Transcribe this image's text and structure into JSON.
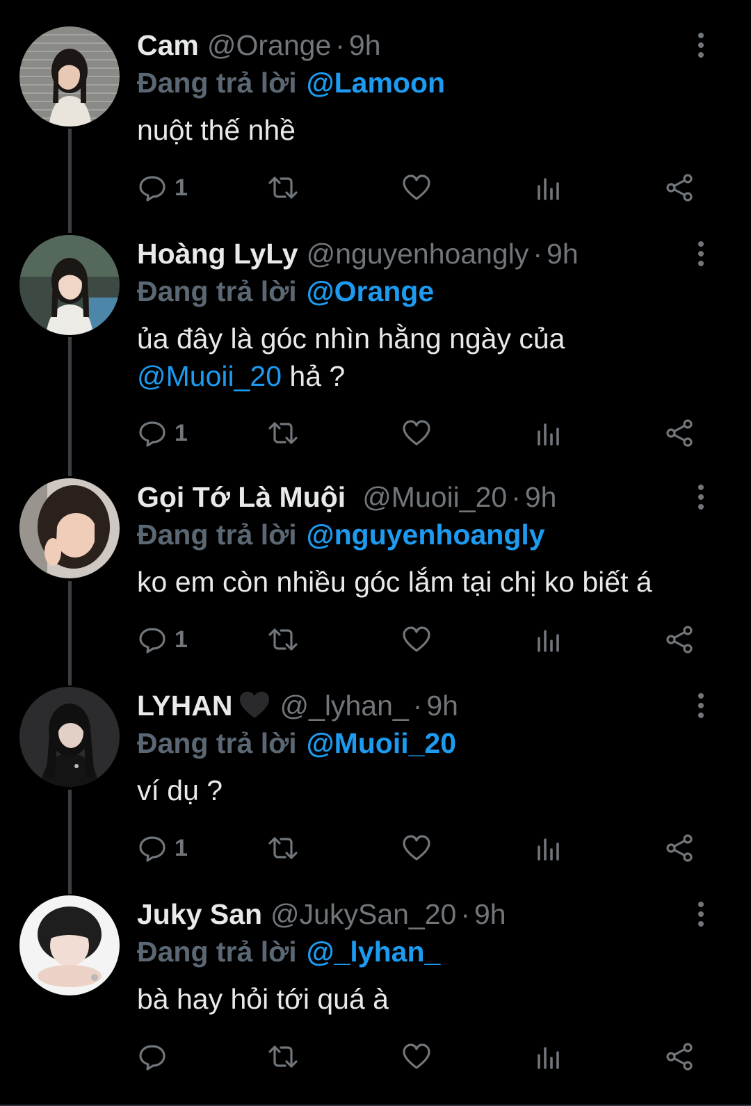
{
  "colors": {
    "background": "#000000",
    "text": "#e7e9ea",
    "muted": "#71767b",
    "accent": "#1d9bf0",
    "thread_line": "#3b3f44"
  },
  "icons": {
    "reply": "speech-bubble-icon",
    "retweet": "retweet-icon",
    "like": "heart-icon",
    "views": "bar-chart-icon",
    "share": "share-icon",
    "more": "vertical-ellipsis-icon"
  },
  "tweets": [
    {
      "display_name": "Cam",
      "handle": "@Orange",
      "dot": "·",
      "time": "9h",
      "reply_prefix": "Đang trả lời",
      "reply_to": "@Lamoon",
      "text_before": "nuột thế nhề",
      "text_mention": "",
      "text_after": "",
      "reply_count": "1"
    },
    {
      "display_name": "Hoàng LyLy",
      "handle": "@nguyenhoangly",
      "dot": "·",
      "time": "9h",
      "reply_prefix": "Đang trả lời",
      "reply_to": "@Orange",
      "text_before": "ủa đây là góc nhìn hằng ngày của ",
      "text_mention": "@Muoii_20",
      "text_after": " hả ?",
      "reply_count": "1"
    },
    {
      "display_name": "Gọi Tớ Là Muội",
      "handle": "@Muoii_20",
      "dot": "·",
      "time": "9h",
      "reply_prefix": "Đang trả lời",
      "reply_to": "@nguyenhoangly",
      "text_before": "ko em còn nhiều góc lắm tại chị ko biết á",
      "text_mention": "",
      "text_after": "",
      "reply_count": "1"
    },
    {
      "display_name": "LYHAN",
      "name_emoji": "black-heart-icon",
      "handle": "@_lyhan_",
      "dot": "·",
      "time": "9h",
      "reply_prefix": "Đang trả lời",
      "reply_to": "@Muoii_20",
      "text_before": "ví dụ ?",
      "text_mention": "",
      "text_after": "",
      "reply_count": "1"
    },
    {
      "display_name": "Juky San",
      "handle": "@JukySan_20",
      "dot": "·",
      "time": "9h",
      "reply_prefix": "Đang trả lời",
      "reply_to": "@_lyhan_",
      "text_before": "bà hay hỏi tới quá à",
      "text_mention": "",
      "text_after": "",
      "reply_count": ""
    }
  ]
}
